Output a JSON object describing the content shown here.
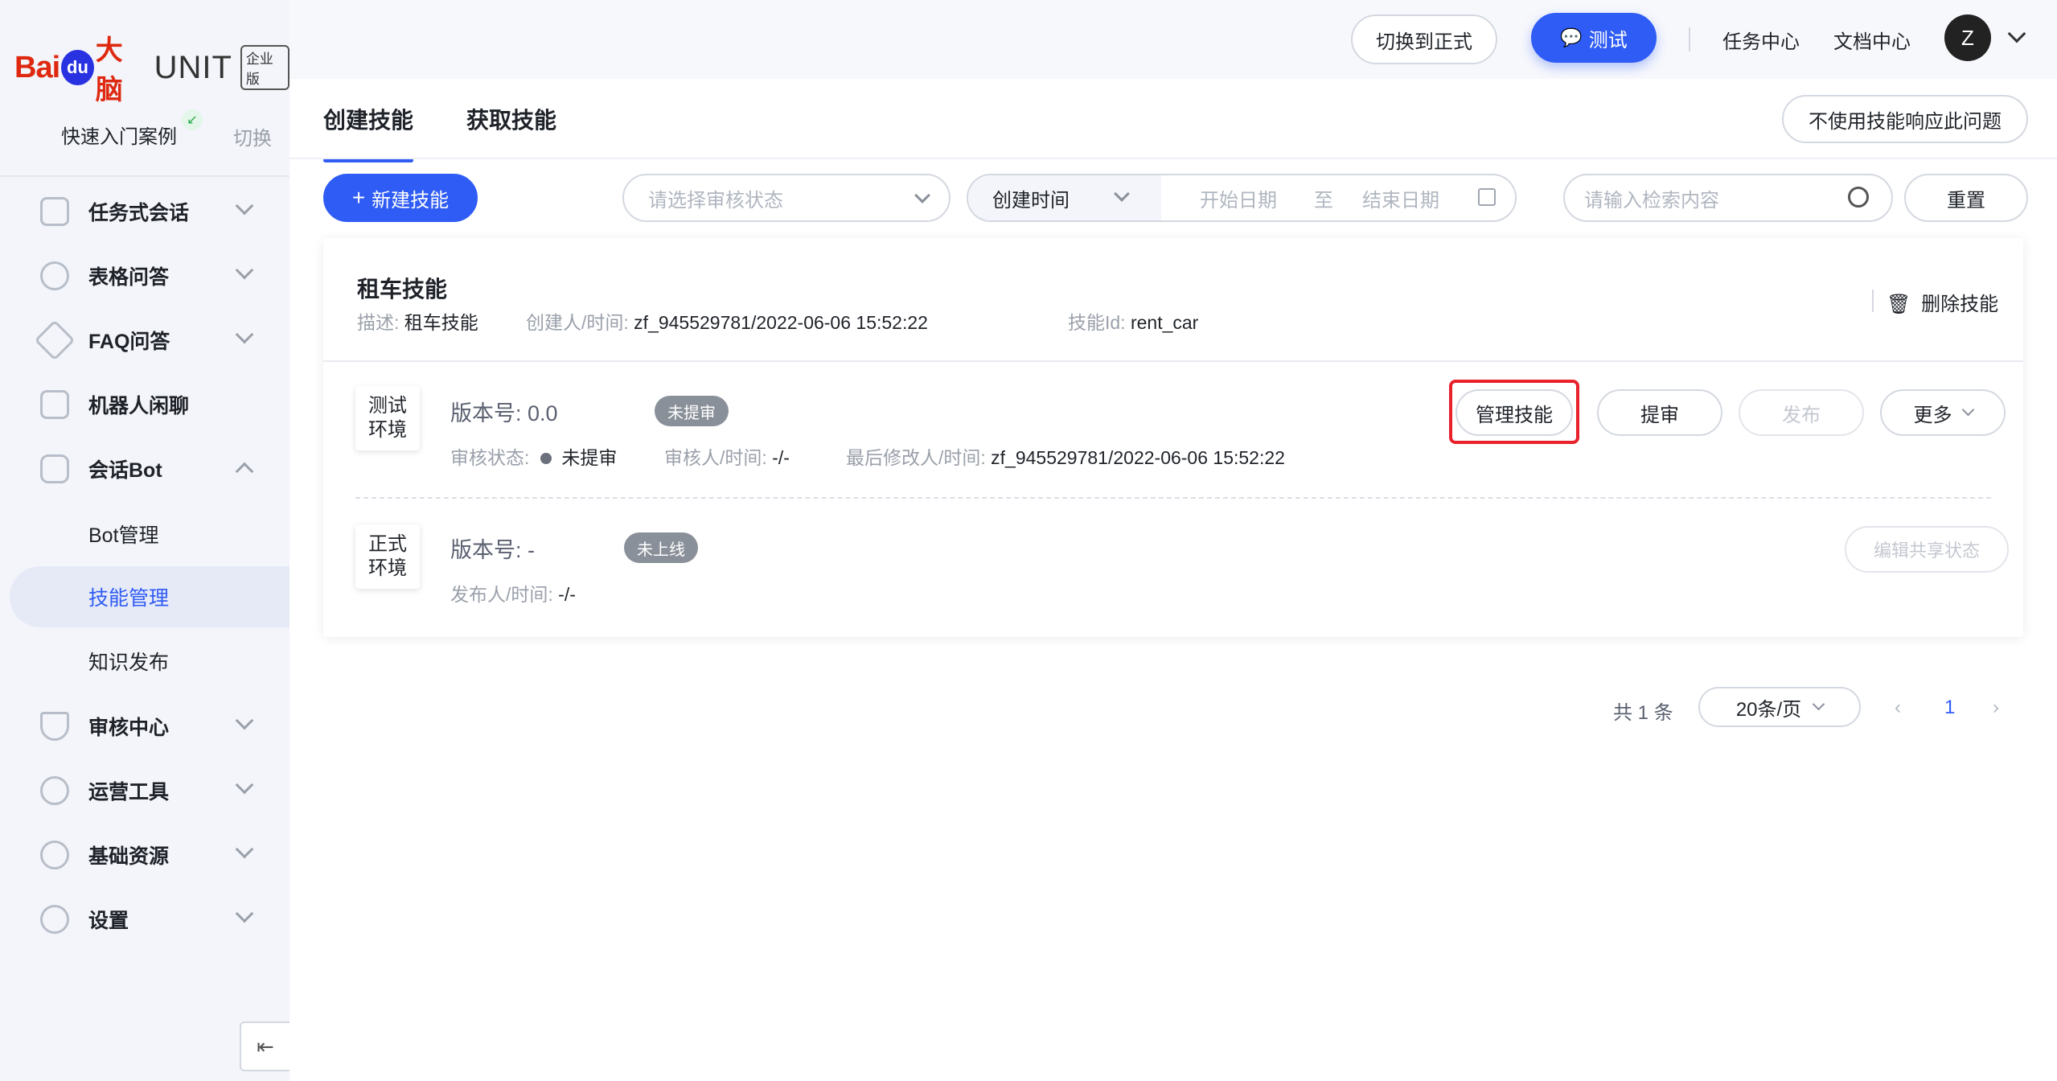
{
  "brand": {
    "bai": "Bai",
    "du": "du",
    "danao": "大脑",
    "product": "UNIT",
    "edition": "企业版"
  },
  "sidebar": {
    "quick_start": "快速入门案例",
    "switch": "切换",
    "items": [
      {
        "label": "任务式会话",
        "icon": "tree-icon"
      },
      {
        "label": "表格问答",
        "icon": "graph-icon"
      },
      {
        "label": "FAQ问答",
        "icon": "question-icon"
      },
      {
        "label": "机器人闲聊",
        "icon": "chat-icon"
      },
      {
        "label": "会话Bot",
        "icon": "bot-icon"
      },
      {
        "label": "审核中心",
        "icon": "shield-icon"
      },
      {
        "label": "运营工具",
        "icon": "tool-icon"
      },
      {
        "label": "基础资源",
        "icon": "cubes-icon"
      },
      {
        "label": "设置",
        "icon": "gear-icon"
      }
    ],
    "sub_items": [
      "Bot管理",
      "技能管理",
      "知识发布"
    ]
  },
  "header": {
    "switch_prod": "切换到正式",
    "test": "测试",
    "task_center": "任务中心",
    "doc_center": "文档中心",
    "avatar": "Z"
  },
  "tabs": [
    "创建技能",
    "获取技能"
  ],
  "no_skill_response": "不使用技能响应此问题",
  "toolbar": {
    "new_skill": "新建技能",
    "review_placeholder": "请选择审核状态",
    "time_select": "创建时间",
    "start_date": "开始日期",
    "to": "至",
    "end_date": "结束日期",
    "search_placeholder": "请输入检索内容",
    "reset": "重置"
  },
  "skill": {
    "name": "租车技能",
    "desc_label": "描述:",
    "desc": "租车技能",
    "creator_label": "创建人/时间:",
    "creator": "zf_945529781/2022-06-06 15:52:22",
    "id_label": "技能Id:",
    "id": "rent_car",
    "delete": "删除技能",
    "test_env": {
      "line1": "测试",
      "line2": "环境"
    },
    "test_version_label": "版本号:",
    "test_version": "0.0",
    "test_tag": "未提审",
    "review_status_label": "审核状态:",
    "review_status": "未提审",
    "reviewer_label": "审核人/时间:",
    "reviewer": "-/-",
    "modifier_label": "最后修改人/时间:",
    "modifier": "zf_945529781/2022-06-06 15:52:22",
    "manage": "管理技能",
    "submit": "提审",
    "publish": "发布",
    "more": "更多",
    "prod_env": {
      "line1": "正式",
      "line2": "环境"
    },
    "prod_version_label": "版本号:",
    "prod_version": "-",
    "prod_tag": "未上线",
    "publisher_label": "发布人/时间:",
    "publisher": "-/-",
    "edit_share": "编辑共享状态"
  },
  "pagination": {
    "total": "共 1 条",
    "page_size": "20条/页",
    "page": "1"
  }
}
